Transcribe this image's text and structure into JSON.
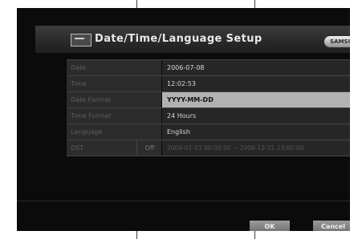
{
  "header": {
    "title": "Date/Time/Language Setup",
    "brand": "SAMSUNG"
  },
  "settings": [
    {
      "label": "Date",
      "value": "2006-07-08"
    },
    {
      "label": "Time",
      "value": "12:02:53"
    },
    {
      "label": "Date Format",
      "value": "YYYY-MM-DD",
      "selected": true
    },
    {
      "label": "Time Format",
      "value": "24 Hours"
    },
    {
      "label": "Language",
      "value": "English"
    }
  ],
  "dst": {
    "label": "DST",
    "state": "Off",
    "range": "2006-01-01 00:00:00 ~ 2006-12-31 23:00:00"
  },
  "buttons": {
    "ok": "OK",
    "cancel": "Cancel"
  },
  "colors": {
    "background": "#0b0b0b",
    "row_label": "#2c2c2c",
    "selected_row": "#b2b2b2"
  },
  "icons": {
    "title": "setup-monitor-icon"
  }
}
